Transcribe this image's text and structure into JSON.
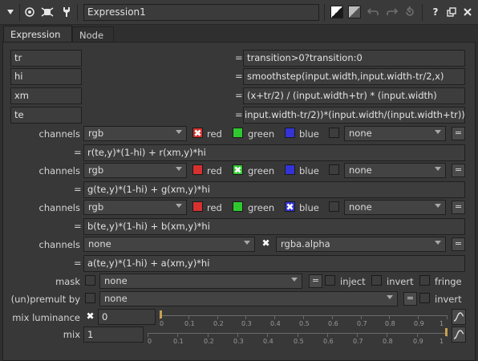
{
  "node": {
    "name": "Expression1",
    "tabs": [
      "Expression",
      "Node"
    ],
    "help_label": "?"
  },
  "temps": [
    {
      "name": "tr",
      "expr": "transition>0?transition:0"
    },
    {
      "name": "hi",
      "expr": "smoothstep(input.width,input.width-tr/2,x)"
    },
    {
      "name": "xm",
      "expr": "(x+tr/2) / (input.width+tr) * (input.width)"
    },
    {
      "name": "te",
      "expr": "input.width-tr/2))*(input.width/(input.width+tr))"
    }
  ],
  "equals": "=",
  "channels_label": "channels",
  "channel_groups": [
    {
      "layer": "rgb",
      "r": "red",
      "g": "green",
      "b": "blue",
      "extra": "none",
      "expr": "r(te,y)*(1-hi) + r(xm,y)*hi",
      "checked": "red"
    },
    {
      "layer": "rgb",
      "r": "red",
      "g": "green",
      "b": "blue",
      "extra": "none",
      "expr": "g(te,y)*(1-hi) + g(xm,y)*hi",
      "checked": "green"
    },
    {
      "layer": "rgb",
      "r": "red",
      "g": "green",
      "b": "blue",
      "extra": "none",
      "expr": "b(te,y)*(1-hi) + b(xm,y)*hi",
      "checked": "blue"
    }
  ],
  "alpha_group": {
    "layer": "none",
    "channel": "rgba.alpha",
    "expr": "a(te,y)*(1-hi) + a(xm,y)*hi"
  },
  "mask": {
    "label": "mask",
    "value": "none",
    "inject": "inject",
    "invert": "invert",
    "fringe": "fringe"
  },
  "unpremult": {
    "label": "(un)premult by",
    "value": "none",
    "invert": "invert"
  },
  "mix_luminance": {
    "label": "mix luminance",
    "value": "0"
  },
  "mix": {
    "label": "mix",
    "value": "1"
  },
  "slider_ticks": [
    "0",
    "0.1",
    "0.2",
    "0.3",
    "0.4",
    "0.5",
    "0.6",
    "0.7",
    "0.8",
    "0.9",
    "1"
  ],
  "slider_levels": {
    "mix_luminance": 0,
    "mix": 1
  },
  "colors": {
    "red": "#d63030",
    "green": "#2fc92f",
    "blue": "#3333d6",
    "slider_handle": "#c8a050"
  }
}
